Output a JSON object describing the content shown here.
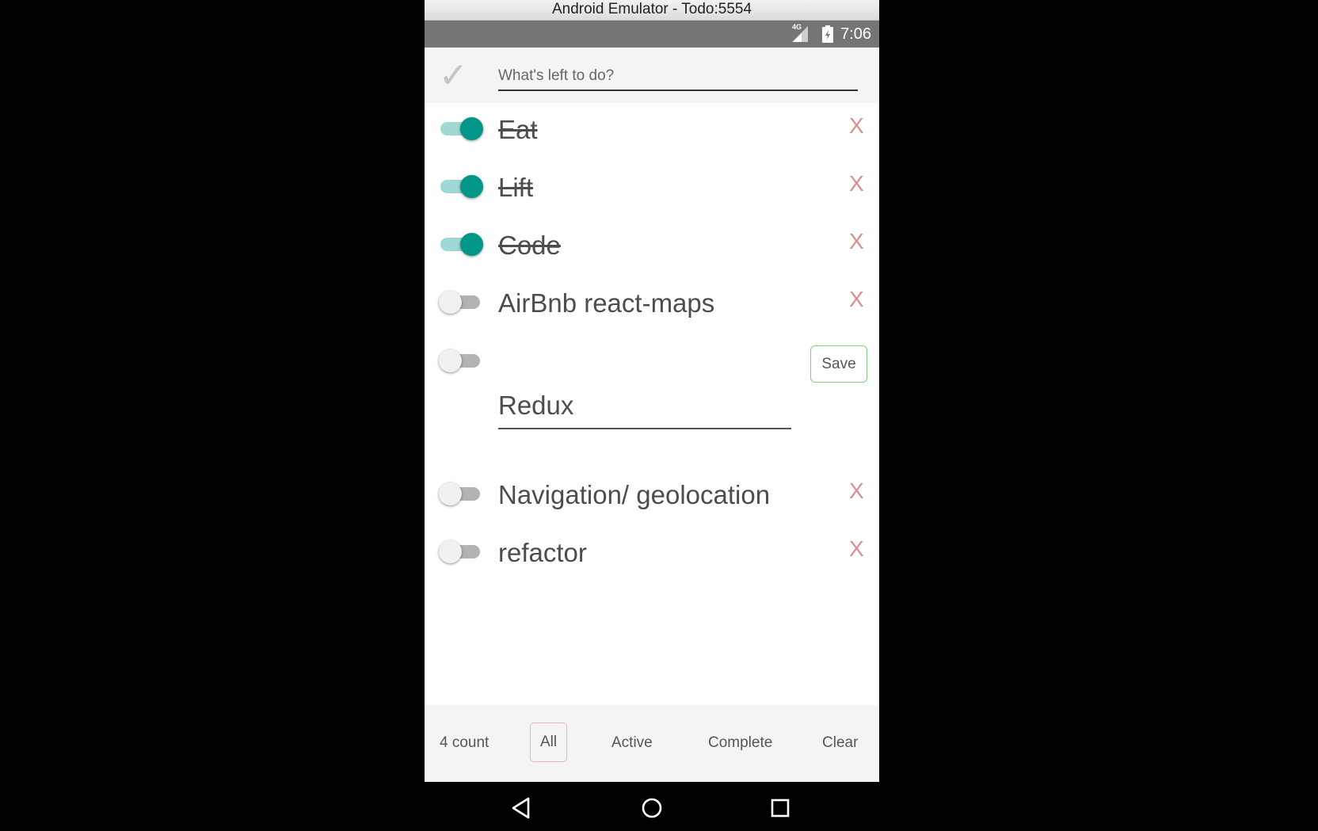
{
  "window": {
    "title": "Android Emulator - Todo:5554"
  },
  "status_bar": {
    "network": "4G",
    "time": "7:06"
  },
  "header": {
    "placeholder": "What's left to do?",
    "toggle_all_glyph": "✓"
  },
  "todos": [
    {
      "text": "Eat",
      "complete": true,
      "remove_label": "X"
    },
    {
      "text": "Lift",
      "complete": true,
      "remove_label": "X"
    },
    {
      "text": "Code",
      "complete": true,
      "remove_label": "X"
    },
    {
      "text": "AirBnb react-maps",
      "complete": false,
      "remove_label": "X"
    }
  ],
  "editing_todo": {
    "value": "Redux",
    "complete": false,
    "save_label": "Save"
  },
  "todos_after": [
    {
      "text": "Navigation/ geolocation",
      "complete": false,
      "remove_label": "X"
    },
    {
      "text": "refactor",
      "complete": false,
      "remove_label": "X"
    }
  ],
  "footer": {
    "count": "4 count",
    "filters": {
      "all": "All",
      "active": "Active",
      "complete": "Complete"
    },
    "selected_filter": "All",
    "clear": "Clear"
  },
  "colors": {
    "switch_on_thumb": "#009688",
    "switch_on_track": "#9fd8d4",
    "remove": "#d88f8f",
    "save_border": "#7dd07f",
    "filter_selected_border": "#e6b8b8"
  },
  "icons": {
    "nav": [
      "back-icon",
      "home-icon",
      "recents-icon"
    ],
    "status": [
      "signal-icon",
      "battery-icon"
    ]
  }
}
